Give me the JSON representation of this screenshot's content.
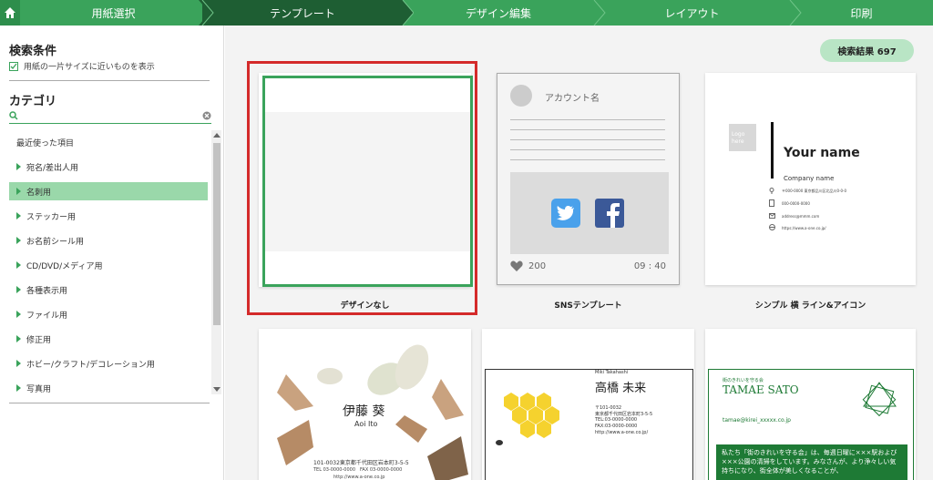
{
  "nav": {
    "steps": [
      "用紙選択",
      "テンプレート",
      "デザイン編集",
      "レイアウト",
      "印刷"
    ],
    "active": 1
  },
  "sidebar": {
    "conditions_title": "検索条件",
    "condition_option": "用紙の一片サイズに近いものを表示",
    "category_title": "カテゴリ",
    "search_placeholder": "",
    "items": [
      "最近使った項目",
      "宛名/差出人用",
      "名刺用",
      "ステッカー用",
      "お名前シール用",
      "CD/DVD/メディア用",
      "各種表示用",
      "ファイル用",
      "修正用",
      "ホビー/クラフト/デコレーション用",
      "写真用"
    ],
    "selected_index": 2
  },
  "results": {
    "label": "検索結果 697"
  },
  "templates": [
    {
      "caption": "デザインなし"
    },
    {
      "caption": "SNSテンプレート",
      "account": "アカウント名",
      "likes": "200",
      "time": "09 : 40"
    },
    {
      "caption": "シンプル 横 ライン&アイコン",
      "logo": "Logo here",
      "name": "Your name",
      "company": "Company name",
      "address": "〒000-0000 東京都品川区北品川0-0-0",
      "phone": "000-0000-0000",
      "email": "address@mmm.com",
      "url": "https://www.a-one.co.jp/"
    },
    {
      "name": "伊藤 葵",
      "romaji": "Aoi Ito",
      "address": "101-0032東京都千代田区岩本町3-5-5",
      "tel": "TEL 03-0000-0000　FAX 03-0000-0000",
      "url": "http://www.a-one.co.jp"
    },
    {
      "romaji": "Miki Takahashi",
      "name": "高橋 未来",
      "zip": "〒101-0032",
      "address": "東京都千代田区岩本町3-5-5",
      "tel": "TEL:03-0000-0000",
      "fax": "FAX:03-0000-0000",
      "url": "http://www.a-one.co.jp/"
    },
    {
      "org": "街のきれいを守る会",
      "name": "TAMAE SATO",
      "email": "tamae@kirei_xxxxx.co.jp",
      "text": "私たち「街のきれいを守る会」は、毎週日曜に×××駅および×××公園の清掃をしています。みなさんが、より浄々しい気持ちになり、街全体が美しくなることが、"
    }
  ],
  "colors": {
    "accent": "#3aa35b",
    "dark": "#1e5e33",
    "highlight": "#d42a2a"
  }
}
